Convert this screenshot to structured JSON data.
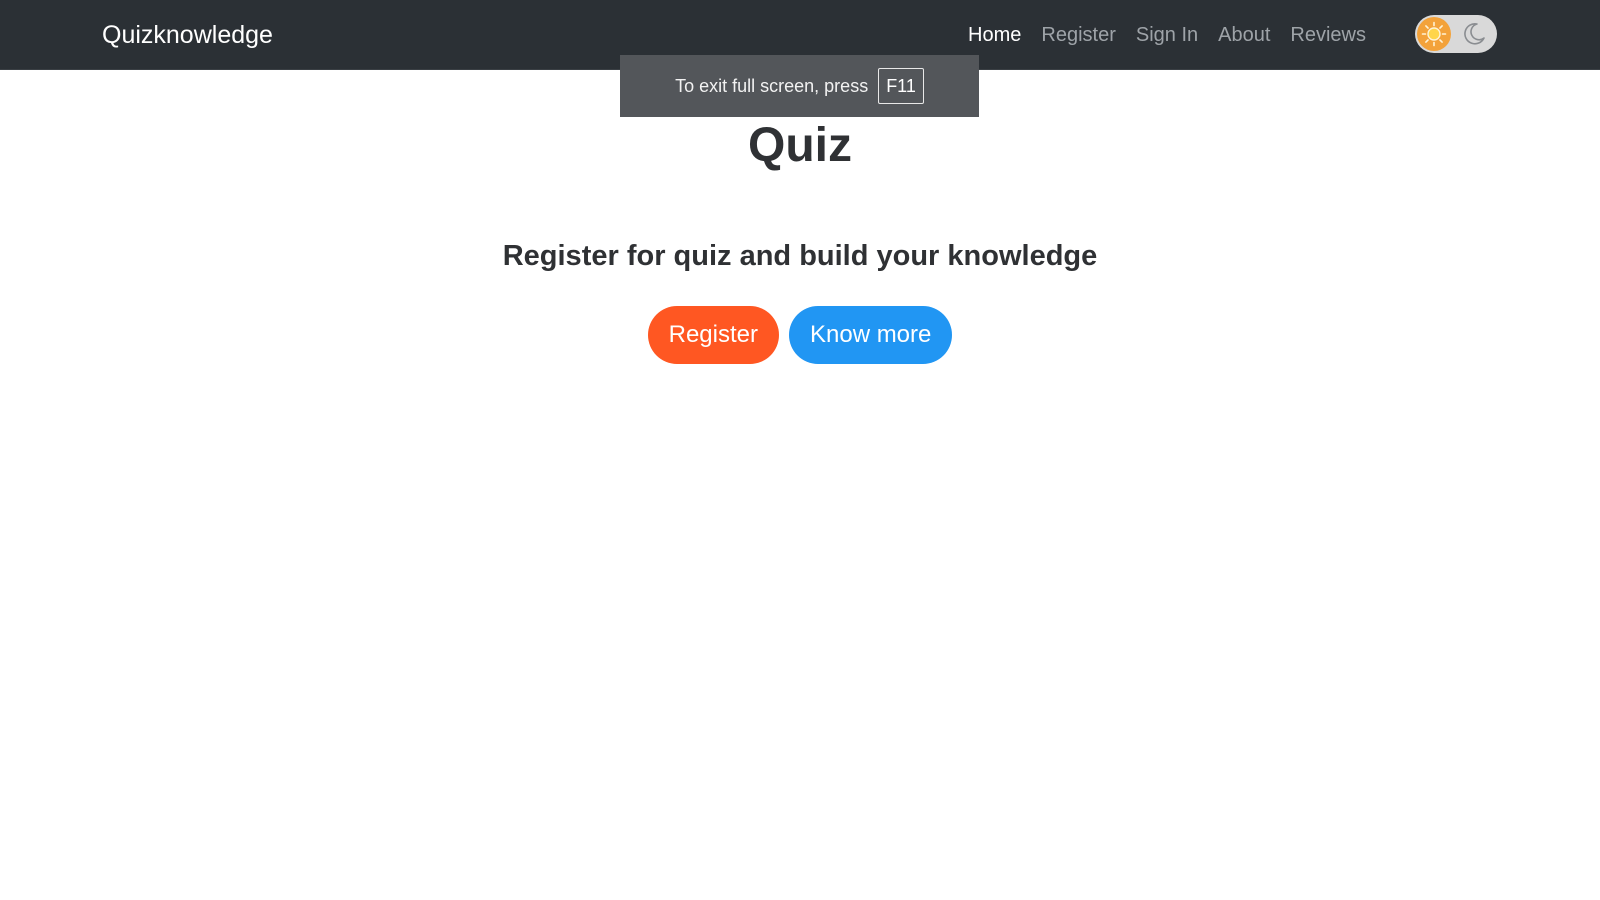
{
  "navbar": {
    "brand": "Quizknowledge",
    "links": [
      {
        "label": "Home",
        "active": true
      },
      {
        "label": "Register",
        "active": false
      },
      {
        "label": "Sign In",
        "active": false
      },
      {
        "label": "About",
        "active": false
      },
      {
        "label": "Reviews",
        "active": false
      }
    ],
    "theme_toggle": {
      "state": "light",
      "icons": [
        "sun-icon",
        "moon-icon"
      ]
    }
  },
  "fullscreen_notice": {
    "text": "To exit full screen, press",
    "key": "F11"
  },
  "hero": {
    "title": "Quiz",
    "subtitle": "Register for quiz and build your knowledge",
    "register_label": "Register",
    "know_more_label": "Know more"
  },
  "colors": {
    "navbar_bg": "#2b3035",
    "register_button": "#ff5722",
    "know_more_button": "#2196f3",
    "toast_bg": "#53565a"
  }
}
